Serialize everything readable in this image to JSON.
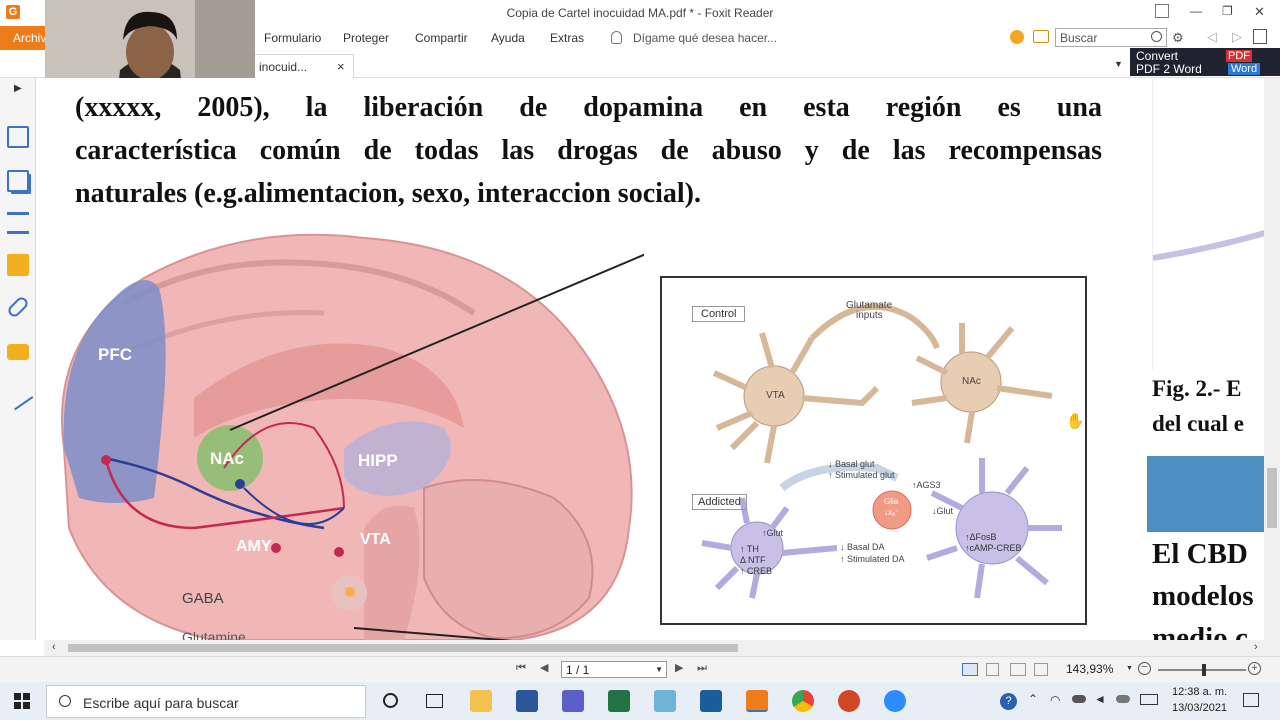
{
  "window": {
    "title": "Copia de Cartel inocuidad MA.pdf * - Foxit Reader",
    "archive_tab": "Archivo",
    "doc_tab": "tel inocuid...",
    "tab_close": "×"
  },
  "ribbon": {
    "menus": [
      "Formulario",
      "Proteger",
      "Compartir",
      "Ayuda",
      "Extras"
    ],
    "tell_me": "Dígame qué desea hacer...",
    "search_placeholder": "Buscar",
    "convert_line1": "Convert",
    "convert_line2": "PDF 2 Word",
    "pdf_badge": "PDF",
    "word_badge": "Word"
  },
  "document": {
    "line1": "(xxxxx, 2005), la liberación de dopamina en esta región es una",
    "line2": "característica común de todas las drogas de abuso y de las recompensas",
    "line3": "naturales (e.g.alimentacion, sexo, interaccion social).",
    "figure": {
      "brain_labels": {
        "pfc": "PFC",
        "nac": "NAc",
        "hipp": "HIPP",
        "amy": "AMY",
        "vta": "VTA"
      },
      "legend": {
        "gaba": "GABA",
        "glutamine": "Glutamine"
      },
      "inset": {
        "control": "Control",
        "glutamate_inputs_1": "Glutamate",
        "glutamate_inputs_2": "inputs",
        "vta": "VTA",
        "nac": "NAc",
        "addicted": "Addicted",
        "basal_glut": "↓ Basal glut",
        "stim_glut": "↑ Stimulated glut",
        "ags3": "↑AGS3",
        "glia_1": "Glia",
        "glia_2": "↓xₐ⁻",
        "glut_down": "↓Glut",
        "glut_up": "↑Glut",
        "th": "↑ TH",
        "ntf": "Δ NTF",
        "creb": "↑ CREB",
        "basal_da": "↓ Basal DA",
        "stim_da": "↑ Stimulated DA",
        "fosb": "↑ΔFosB",
        "camp": "↑cAMP-CREB"
      }
    }
  },
  "right_panel": {
    "fig_line1": "Fig. 2.- E",
    "fig_line2": "del cual e",
    "cbd_line1": "El CBD",
    "cbd_line2": "modelos",
    "cbd_line3": "medio c"
  },
  "status": {
    "page": "1 / 1",
    "zoom": "143,93%"
  },
  "taskbar": {
    "search": "Escribe aquí para buscar",
    "time": "12:38 a. m.",
    "date": "13/03/2021"
  }
}
